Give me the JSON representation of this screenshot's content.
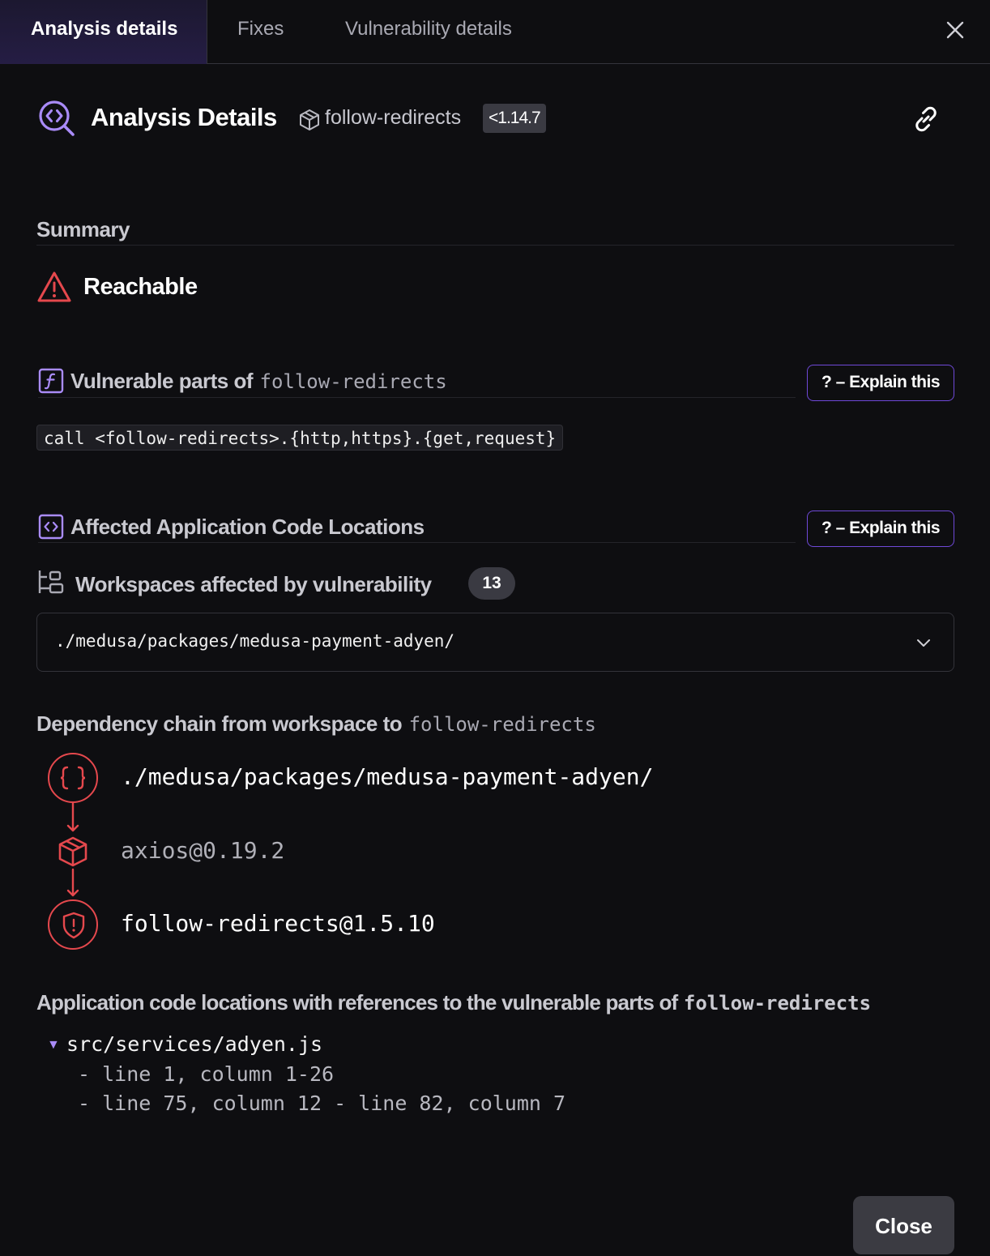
{
  "tabs": [
    {
      "label": "Analysis details",
      "active": true
    },
    {
      "label": "Fixes",
      "active": false
    },
    {
      "label": "Vulnerability details",
      "active": false
    }
  ],
  "header": {
    "title": "Analysis Details",
    "package": "follow-redirects",
    "version_badge": "<1.14.7"
  },
  "summary": {
    "label": "Summary",
    "status": "Reachable"
  },
  "vulnerable_parts": {
    "title_prefix": "Vulnerable parts of",
    "package": "follow-redirects",
    "explain_label": "? – Explain this",
    "call": "call <follow-redirects>.{http,https}.{get,request}"
  },
  "affected_locations": {
    "title": "Affected Application Code Locations",
    "explain_label": "? – Explain this",
    "workspaces_label": "Workspaces affected by vulnerability",
    "workspace_count": "13",
    "selected_workspace": "./medusa/packages/medusa-payment-adyen/"
  },
  "dependency_chain": {
    "title_prefix": "Dependency chain from workspace to",
    "package": "follow-redirects",
    "nodes": [
      {
        "label": "./medusa/packages/medusa-payment-adyen/",
        "icon": "braces-icon"
      },
      {
        "label": "axios@0.19.2",
        "icon": "package-icon"
      },
      {
        "label": "follow-redirects@1.5.10",
        "icon": "shield-alert-icon"
      }
    ]
  },
  "code_locations": {
    "title_prefix": "Application code locations with references to the vulnerable parts of",
    "package": "follow-redirects",
    "file": "src/services/adyen.js",
    "lines": [
      "- line 1, column 1-26",
      "- line 75, column 12 - line 82, column 7"
    ]
  },
  "footer": {
    "close_label": "Close"
  },
  "colors": {
    "accent_purple": "#a98bf8",
    "danger_red": "#e5484d"
  }
}
